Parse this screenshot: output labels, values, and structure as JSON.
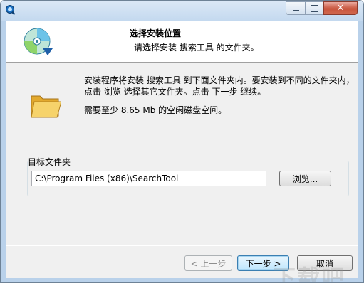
{
  "header": {
    "title": "选择安装位置",
    "subtitle": "请选择安装 搜索工具 的文件夹。"
  },
  "body": {
    "description_line1": "安装程序将安装 搜索工具 到下面文件夹内。要安装到不同的文件夹内，点击 浏览 选择其它文件夹。点击 下一步 继续。",
    "space_required": "需要至少 8.65 Mb 的空闲磁盘空间。"
  },
  "destination": {
    "group_label": "目标文件夹",
    "path_value": "C:\\Program Files (x86)\\SearchTool",
    "browse_label": "浏览..."
  },
  "footer": {
    "back_label": "< 上一步",
    "next_label": "下一步 >",
    "cancel_label": "取消"
  },
  "watermark": "下载吧",
  "icons": {
    "app": "search-app-icon",
    "header": "disc-install-icon",
    "folder": "folder-icon"
  },
  "colors": {
    "title_bar": "#c4d9ef",
    "close_button": "#c8553d",
    "client_background": "#f0f0f0",
    "header_background": "#ffffff",
    "folder_yellow": "#f2c44f"
  }
}
